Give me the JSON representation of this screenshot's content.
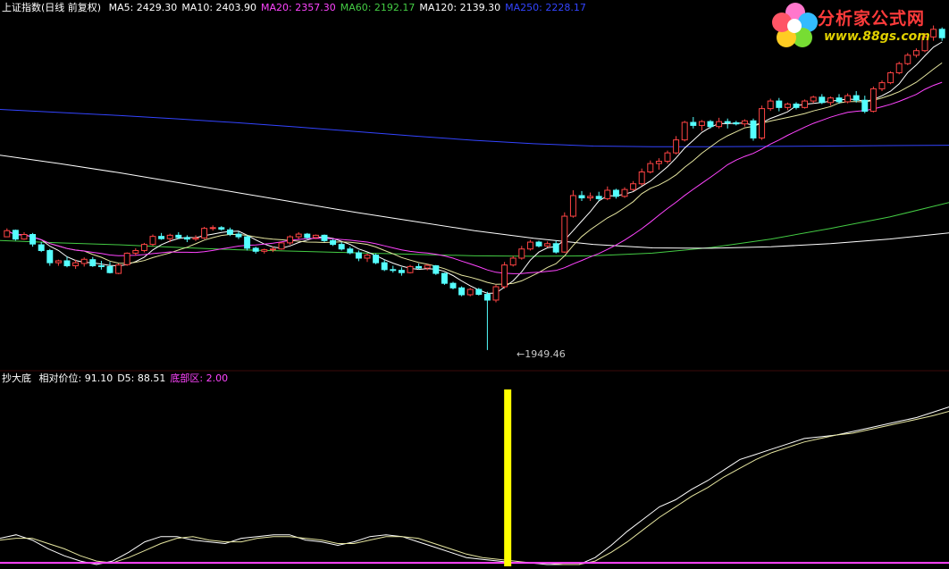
{
  "top_panel": {
    "title": "上证指数(日线 前复权)",
    "indicators": [
      {
        "label": "MA5: 2429.30",
        "color": "#ffffff"
      },
      {
        "label": "MA10: 2403.90",
        "color": "#ffffff"
      },
      {
        "label": "MA20: 2357.30",
        "color": "#ff44ff"
      },
      {
        "label": "MA60: 2192.17",
        "color": "#44cc44"
      },
      {
        "label": "MA120: 2139.30",
        "color": "#ffffff"
      },
      {
        "label": "MA250: 2228.17",
        "color": "#3344ff"
      }
    ],
    "low_marker": "←1949.46"
  },
  "bottom_panel": {
    "name": "抄大底",
    "indicators": [
      {
        "label": "相对价位: 91.10",
        "color": "#ffffff"
      },
      {
        "label": "D5: 88.51",
        "color": "#ffffff"
      },
      {
        "label": "底部区: 2.00",
        "color": "#ff44ff"
      }
    ]
  },
  "watermark": {
    "text": "分析家公式网",
    "url": "www.88gs.com"
  },
  "chart_data": [
    {
      "type": "candlestick",
      "title": "上证指数(日线 前复权)",
      "up_color": "#ff4444",
      "down_color": "#55ffff",
      "candles_ohlc": [
        [
          2246,
          2268,
          2245,
          2262
        ],
        [
          2263,
          2265,
          2236,
          2240
        ],
        [
          2240,
          2258,
          2238,
          2252
        ],
        [
          2252,
          2256,
          2220,
          2227
        ],
        [
          2225,
          2232,
          2206,
          2210
        ],
        [
          2210,
          2214,
          2170,
          2178
        ],
        [
          2178,
          2186,
          2170,
          2183
        ],
        [
          2183,
          2194,
          2166,
          2170
        ],
        [
          2170,
          2186,
          2162,
          2178
        ],
        [
          2176,
          2192,
          2168,
          2187
        ],
        [
          2186,
          2193,
          2167,
          2170
        ],
        [
          2170,
          2183,
          2160,
          2168
        ],
        [
          2168,
          2180,
          2150,
          2152
        ],
        [
          2150,
          2176,
          2148,
          2172
        ],
        [
          2173,
          2205,
          2170,
          2203
        ],
        [
          2203,
          2216,
          2196,
          2210
        ],
        [
          2210,
          2230,
          2205,
          2226
        ],
        [
          2226,
          2252,
          2222,
          2247
        ],
        [
          2247,
          2256,
          2238,
          2241
        ],
        [
          2241,
          2254,
          2232,
          2250
        ],
        [
          2250,
          2258,
          2240,
          2244
        ],
        [
          2244,
          2250,
          2232,
          2240
        ],
        [
          2240,
          2250,
          2235,
          2243
        ],
        [
          2243,
          2272,
          2240,
          2268
        ],
        [
          2268,
          2276,
          2262,
          2270
        ],
        [
          2270,
          2274,
          2262,
          2266
        ],
        [
          2264,
          2270,
          2248,
          2253
        ],
        [
          2253,
          2260,
          2240,
          2246
        ],
        [
          2246,
          2250,
          2210,
          2216
        ],
        [
          2216,
          2220,
          2202,
          2208
        ],
        [
          2208,
          2215,
          2202,
          2212
        ],
        [
          2212,
          2220,
          2206,
          2214
        ],
        [
          2214,
          2232,
          2212,
          2230
        ],
        [
          2230,
          2250,
          2225,
          2246
        ],
        [
          2246,
          2258,
          2240,
          2253
        ],
        [
          2253,
          2256,
          2240,
          2244
        ],
        [
          2244,
          2252,
          2240,
          2250
        ],
        [
          2250,
          2252,
          2232,
          2236
        ],
        [
          2236,
          2240,
          2222,
          2226
        ],
        [
          2226,
          2232,
          2210,
          2214
        ],
        [
          2214,
          2220,
          2200,
          2204
        ],
        [
          2204,
          2210,
          2182,
          2190
        ],
        [
          2190,
          2202,
          2180,
          2198
        ],
        [
          2198,
          2202,
          2174,
          2178
        ],
        [
          2178,
          2186,
          2156,
          2160
        ],
        [
          2160,
          2170,
          2152,
          2158
        ],
        [
          2158,
          2166,
          2144,
          2152
        ],
        [
          2152,
          2172,
          2150,
          2168
        ],
        [
          2168,
          2176,
          2160,
          2164
        ],
        [
          2164,
          2174,
          2158,
          2171
        ],
        [
          2170,
          2172,
          2146,
          2150
        ],
        [
          2150,
          2152,
          2120,
          2124
        ],
        [
          2124,
          2128,
          2108,
          2112
        ],
        [
          2112,
          2116,
          2090,
          2094
        ],
        [
          2094,
          2112,
          2090,
          2108
        ],
        [
          2108,
          2112,
          2092,
          2095
        ],
        [
          2095,
          2102,
          1949,
          2080
        ],
        [
          2080,
          2120,
          2074,
          2115
        ],
        [
          2115,
          2180,
          2110,
          2172
        ],
        [
          2172,
          2196,
          2168,
          2190
        ],
        [
          2190,
          2222,
          2186,
          2214
        ],
        [
          2214,
          2238,
          2210,
          2232
        ],
        [
          2232,
          2236,
          2218,
          2222
        ],
        [
          2222,
          2234,
          2218,
          2228
        ],
        [
          2228,
          2236,
          2202,
          2206
        ],
        [
          2206,
          2310,
          2204,
          2300
        ],
        [
          2300,
          2368,
          2296,
          2354
        ],
        [
          2354,
          2366,
          2340,
          2348
        ],
        [
          2348,
          2362,
          2340,
          2352
        ],
        [
          2352,
          2364,
          2340,
          2346
        ],
        [
          2346,
          2378,
          2342,
          2368
        ],
        [
          2368,
          2372,
          2346,
          2352
        ],
        [
          2352,
          2376,
          2348,
          2370
        ],
        [
          2370,
          2392,
          2366,
          2385
        ],
        [
          2385,
          2425,
          2380,
          2416
        ],
        [
          2416,
          2446,
          2412,
          2438
        ],
        [
          2438,
          2452,
          2422,
          2444
        ],
        [
          2444,
          2472,
          2438,
          2466
        ],
        [
          2466,
          2510,
          2462,
          2500
        ],
        [
          2500,
          2550,
          2496,
          2546
        ],
        [
          2546,
          2560,
          2530,
          2538
        ],
        [
          2538,
          2552,
          2524,
          2548
        ],
        [
          2548,
          2552,
          2530,
          2535
        ],
        [
          2535,
          2558,
          2530,
          2548
        ],
        [
          2548,
          2556,
          2530,
          2545
        ],
        [
          2545,
          2550,
          2538,
          2542
        ],
        [
          2542,
          2554,
          2535,
          2550
        ],
        [
          2550,
          2556,
          2498,
          2505
        ],
        [
          2505,
          2590,
          2500,
          2582
        ],
        [
          2582,
          2608,
          2576,
          2602
        ],
        [
          2602,
          2610,
          2575,
          2585
        ],
        [
          2585,
          2598,
          2578,
          2594
        ],
        [
          2594,
          2599,
          2580,
          2585
        ],
        [
          2585,
          2606,
          2582,
          2602
        ],
        [
          2602,
          2616,
          2596,
          2612
        ],
        [
          2612,
          2620,
          2594,
          2598
        ],
        [
          2598,
          2614,
          2590,
          2610
        ],
        [
          2610,
          2620,
          2595,
          2600
        ],
        [
          2600,
          2622,
          2596,
          2616
        ],
        [
          2616,
          2628,
          2598,
          2604
        ],
        [
          2604,
          2616,
          2570,
          2575
        ],
        [
          2575,
          2640,
          2572,
          2634
        ],
        [
          2634,
          2656,
          2628,
          2650
        ],
        [
          2650,
          2680,
          2646,
          2676
        ],
        [
          2676,
          2705,
          2672,
          2700
        ],
        [
          2700,
          2728,
          2696,
          2722
        ],
        [
          2722,
          2740,
          2716,
          2734
        ],
        [
          2734,
          2780,
          2730,
          2770
        ],
        [
          2770,
          2800,
          2760,
          2790
        ],
        [
          2790,
          2795,
          2760,
          2768
        ]
      ],
      "moving_averages": [
        {
          "name": "MA5",
          "period": 5,
          "color": "#ffffff"
        },
        {
          "name": "MA10",
          "period": 10,
          "color": "#e6e6a0"
        },
        {
          "name": "MA20",
          "period": 20,
          "color": "#ff44ff"
        },
        {
          "name": "MA60",
          "period": 60,
          "color": "#44cc44",
          "values": [
            2236,
            2230,
            2225,
            2218,
            2212,
            2208,
            2204,
            2200,
            2196,
            2195,
            2196,
            2203,
            2218,
            2240,
            2268,
            2298,
            2336
          ]
        },
        {
          "name": "MA120",
          "period": 120,
          "color": "#ffffff",
          "values": [
            2460,
            2438,
            2414,
            2388,
            2362,
            2336,
            2310,
            2286,
            2262,
            2242,
            2226,
            2217,
            2216,
            2220,
            2228,
            2240,
            2256
          ]
        },
        {
          "name": "MA250",
          "period": 250,
          "color": "#3344ff",
          "values": [
            2580,
            2572,
            2564,
            2555,
            2545,
            2534,
            2522,
            2510,
            2499,
            2490,
            2484,
            2482,
            2482,
            2483,
            2484,
            2485,
            2486
          ]
        }
      ],
      "low_label": "←1949.46",
      "ylim": [
        1930,
        2820
      ]
    },
    {
      "type": "line",
      "title": "抄大底",
      "series": [
        {
          "name": "相对价位",
          "color": "#ffffff",
          "values": [
            16,
            18,
            15,
            10,
            6,
            3,
            1,
            3,
            8,
            14,
            17,
            17,
            15,
            14,
            13,
            16,
            17,
            18,
            18,
            15,
            14,
            12,
            14,
            17,
            18,
            17,
            14,
            11,
            8,
            5,
            4,
            3,
            2,
            2,
            1,
            1,
            1,
            5,
            12,
            20,
            27,
            34,
            38,
            44,
            49,
            55,
            61,
            64,
            67,
            70,
            73,
            74,
            75,
            77,
            79,
            81,
            83,
            85,
            88,
            91
          ]
        },
        {
          "name": "D5",
          "color": "#e6e6a0",
          "values": [
            15,
            16,
            16,
            13,
            10,
            6,
            3,
            2,
            5,
            9,
            13,
            16,
            17,
            15,
            14,
            14,
            16,
            17,
            17,
            16,
            15,
            13,
            13,
            15,
            17,
            17,
            16,
            13,
            10,
            7,
            5,
            4,
            3,
            2,
            2,
            1,
            1,
            3,
            8,
            14,
            21,
            28,
            34,
            40,
            45,
            51,
            56,
            61,
            65,
            68,
            71,
            73,
            75,
            76,
            78,
            80,
            82,
            84,
            86,
            88.5
          ]
        },
        {
          "name": "底部区",
          "color": "#ff44ff",
          "values": [
            2,
            2,
            2,
            2,
            2
          ]
        }
      ],
      "signal_bar": {
        "color": "#ffff00",
        "x_fraction_of_panel": 0.535
      },
      "ylim": [
        0,
        100
      ]
    }
  ]
}
